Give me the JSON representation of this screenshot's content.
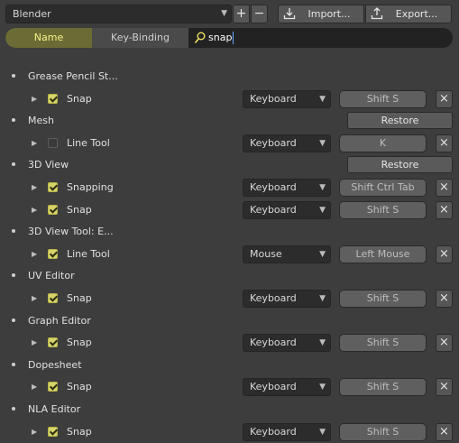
{
  "toolbar": {
    "preset": "Blender",
    "add_label": "+",
    "remove_label": "−",
    "import_label": "Import...",
    "export_label": "Export..."
  },
  "filter": {
    "name_label": "Name",
    "keybinding_label": "Key-Binding",
    "active_mode": "Name",
    "search_value": "snap"
  },
  "groups": [
    {
      "label": "Grease Pencil St...",
      "restore": null,
      "items": [
        {
          "label": "Snap",
          "checked": true,
          "map_type": "Keyboard",
          "key": "Shift S"
        }
      ]
    },
    {
      "label": "Mesh",
      "restore": "Restore",
      "items": [
        {
          "label": "Line Tool",
          "checked": false,
          "map_type": "Keyboard",
          "key": "K"
        }
      ]
    },
    {
      "label": "3D View",
      "restore": "Restore",
      "items": [
        {
          "label": "Snapping",
          "checked": true,
          "map_type": "Keyboard",
          "key": "Shift Ctrl Tab"
        },
        {
          "label": "Snap",
          "checked": true,
          "map_type": "Keyboard",
          "key": "Shift S"
        }
      ]
    },
    {
      "label": "3D View Tool: E...",
      "restore": null,
      "items": [
        {
          "label": "Line Tool",
          "checked": true,
          "map_type": "Mouse",
          "key": "Left Mouse"
        }
      ]
    },
    {
      "label": "UV Editor",
      "restore": null,
      "items": [
        {
          "label": "Snap",
          "checked": true,
          "map_type": "Keyboard",
          "key": "Shift S"
        }
      ]
    },
    {
      "label": "Graph Editor",
      "restore": null,
      "items": [
        {
          "label": "Snap",
          "checked": true,
          "map_type": "Keyboard",
          "key": "Shift S"
        }
      ]
    },
    {
      "label": "Dopesheet",
      "restore": null,
      "items": [
        {
          "label": "Snap",
          "checked": true,
          "map_type": "Keyboard",
          "key": "Shift S"
        }
      ]
    },
    {
      "label": "NLA Editor",
      "restore": null,
      "items": [
        {
          "label": "Snap",
          "checked": true,
          "map_type": "Keyboard",
          "key": "Shift S"
        }
      ]
    }
  ],
  "icons": {
    "remove_item": "close-icon",
    "expander": "triangle-right-icon",
    "search": "search-icon",
    "import": "import-icon",
    "export": "export-icon",
    "dropdown": "chevron-down-icon"
  },
  "colors": {
    "background": "#3d3d3d",
    "active_tab": "#6b6b35",
    "active_tab_text": "#f4f28a",
    "checkbox_on": "#d6d36a",
    "caret": "#6aa6ff"
  }
}
